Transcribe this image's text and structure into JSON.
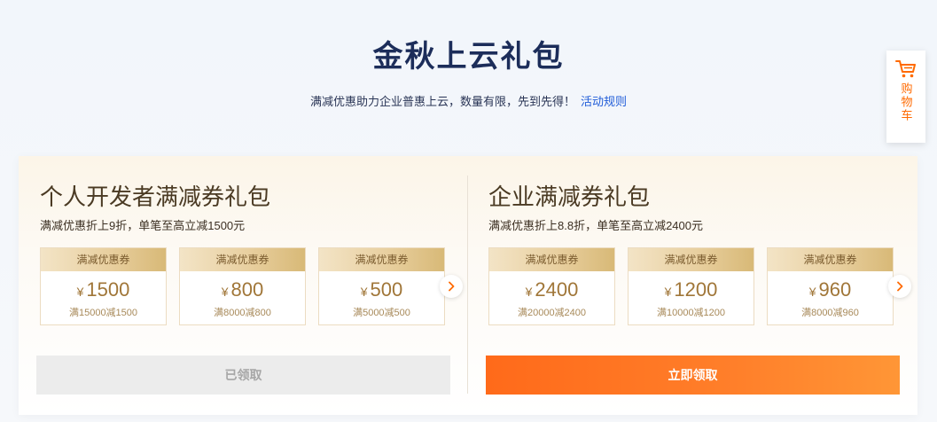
{
  "page": {
    "title": "金秋上云礼包",
    "subtitle": "满减优惠助力企业普惠上云，数量有限，先到先得！",
    "rules_link": "活动规则"
  },
  "cart": {
    "label": "购物车",
    "icon": "cart-icon",
    "accent": "#ff6a00"
  },
  "packs": [
    {
      "title": "个人开发者满减券礼包",
      "desc": "满减优惠折上9折，单笔至高立减1500元",
      "coupons": [
        {
          "head": "满减优惠券",
          "currency": "¥",
          "amount": "1500",
          "cond": "满15000减1500"
        },
        {
          "head": "满减优惠券",
          "currency": "¥",
          "amount": "800",
          "cond": "满8000减800"
        },
        {
          "head": "满减优惠券",
          "currency": "¥",
          "amount": "500",
          "cond": "满5000减500"
        }
      ],
      "button": "已领取",
      "button_state": "disabled"
    },
    {
      "title": "企业满减券礼包",
      "desc": "满减优惠折上8.8折，单笔至高立减2400元",
      "coupons": [
        {
          "head": "满减优惠券",
          "currency": "¥",
          "amount": "2400",
          "cond": "满20000减2400"
        },
        {
          "head": "满减优惠券",
          "currency": "¥",
          "amount": "1200",
          "cond": "满10000减1200"
        },
        {
          "head": "满减优惠券",
          "currency": "¥",
          "amount": "960",
          "cond": "满8000减960"
        }
      ],
      "button": "立即领取",
      "button_state": "active"
    }
  ],
  "colors": {
    "title": "#1c2d5a",
    "link": "#1f5bd8",
    "primary_button": "#ff6a1a",
    "coupon_gold": "#d8b977"
  }
}
